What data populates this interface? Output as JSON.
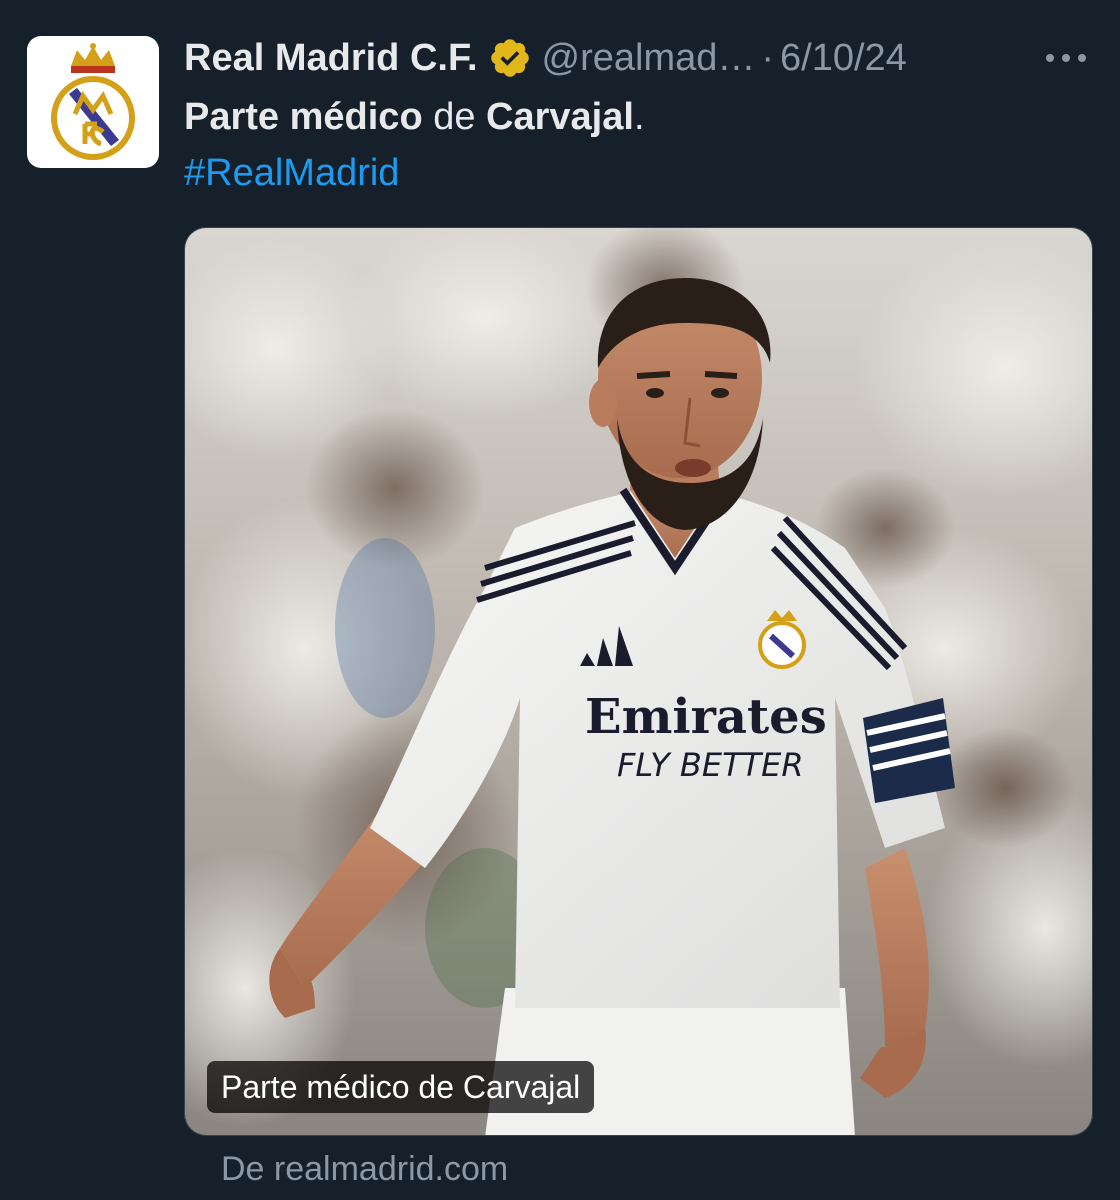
{
  "tweet": {
    "display_name": "Real Madrid C.F.",
    "handle": "@realmad…",
    "separator": "·",
    "date": "6/10/24",
    "text_bold_1": "Parte médico",
    "text_middle": " de ",
    "text_bold_2": "Carvajal",
    "text_end": ".",
    "hashtag": "#RealMadrid",
    "media_caption": "Parte médico de Carvajal",
    "source": "De realmadrid.com"
  },
  "icons": {
    "avatar": "real-madrid-crest-icon",
    "verified": "verified-gold-badge-icon",
    "more": "more-options-icon"
  },
  "colors": {
    "background": "#15202b",
    "text": "#e7e9ea",
    "secondary": "#8b98a5",
    "link": "#1d9bf0",
    "verified_gold": "#e2b719",
    "crest_navy": "#1d3a6e",
    "crest_gold": "#d4a017"
  }
}
